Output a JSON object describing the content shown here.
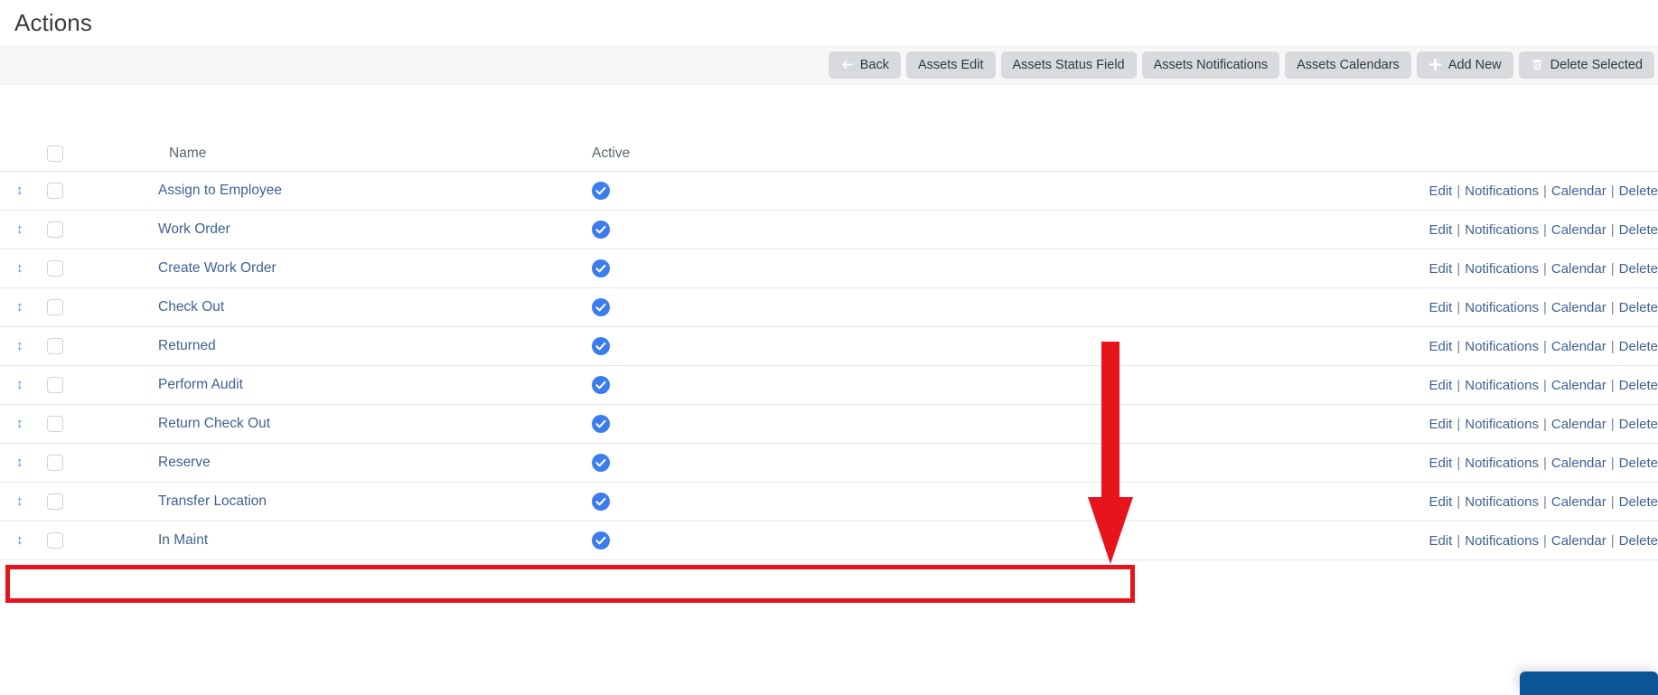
{
  "page": {
    "title": "Actions"
  },
  "toolbar": {
    "buttons": [
      {
        "label": "Back",
        "icon": "arrow-left-icon"
      },
      {
        "label": "Assets Edit",
        "icon": ""
      },
      {
        "label": "Assets Status Field",
        "icon": ""
      },
      {
        "label": "Assets Notifications",
        "icon": ""
      },
      {
        "label": "Assets Calendars",
        "icon": ""
      },
      {
        "label": "Add New",
        "icon": "plus-icon"
      },
      {
        "label": "Delete Selected",
        "icon": "trash-icon"
      }
    ]
  },
  "table": {
    "headers": {
      "handle": "",
      "select": "",
      "name": "Name",
      "active": "Active",
      "actions": ""
    },
    "row_actions": {
      "edit": "Edit",
      "notifications": "Notifications",
      "calendar": "Calendar",
      "delete": "Delete",
      "separator": "|"
    },
    "rows": [
      {
        "name": "Assign to Employee",
        "active": true
      },
      {
        "name": "Work Order",
        "active": true
      },
      {
        "name": "Create Work Order",
        "active": true
      },
      {
        "name": "Check Out",
        "active": true
      },
      {
        "name": "Returned",
        "active": true
      },
      {
        "name": "Perform Audit",
        "active": true
      },
      {
        "name": "Return Check Out",
        "active": true
      },
      {
        "name": "Reserve",
        "active": true
      },
      {
        "name": "Transfer Location",
        "active": true
      },
      {
        "name": "In Maint",
        "active": true
      }
    ]
  },
  "annotations": {
    "highlight_box_target": "Reserve",
    "arrow_target": "Edit",
    "color": "#e8141c"
  },
  "widget": {
    "color": "#0a5596"
  },
  "colors": {
    "link": "#3f6292",
    "active_badge": "#3b7ded",
    "toolbar_button": "#d8dade",
    "toolbar_bg": "#f7f7f8"
  }
}
